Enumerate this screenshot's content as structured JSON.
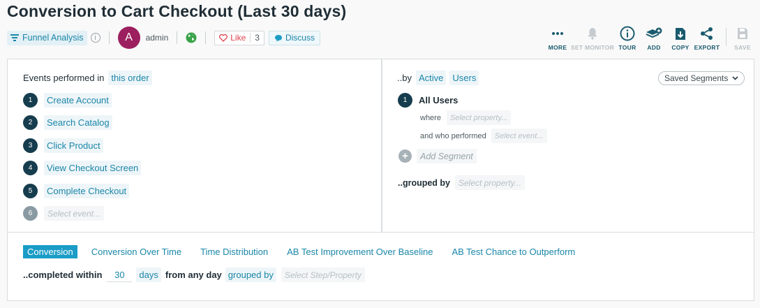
{
  "report": {
    "title": "Conversion to Cart Checkout (Last 30 days)",
    "type_label": "Funnel Analysis",
    "info_glyph": "i",
    "owner_initial": "A",
    "owner_name": "admin",
    "like_label": "Like",
    "like_count": "3",
    "discuss_label": "Discuss",
    "colors": {
      "accent": "#1a86a8",
      "avatar": "#9c1f5f",
      "step": "#163d4e",
      "like": "#e0424f"
    }
  },
  "toolbar": [
    {
      "label": "MORE",
      "icon": "more-icon",
      "disabled": false
    },
    {
      "label": "SET MONITOR",
      "icon": "bell-icon",
      "disabled": true
    },
    {
      "label": "TOUR",
      "icon": "info-icon",
      "disabled": false
    },
    {
      "label": "ADD",
      "icon": "add-stack-icon",
      "disabled": false
    },
    {
      "label": "COPY",
      "icon": "copy-icon",
      "disabled": false
    },
    {
      "label": "EXPORT",
      "icon": "share-icon",
      "disabled": false
    },
    {
      "label": "SAVE",
      "icon": "save-icon",
      "disabled": true
    }
  ],
  "events": {
    "prefix": "Events performed in",
    "order": "this order",
    "steps": [
      "Create Account",
      "Search Catalog",
      "Click Product",
      "View Checkout Screen",
      "Complete Checkout"
    ],
    "next_number": "6",
    "next_placeholder": "Select event..."
  },
  "segments": {
    "by_label": "..by",
    "active": "Active",
    "users": "Users",
    "saved_segments": "Saved Segments",
    "segment_number": "1",
    "segment_name": "All Users",
    "where_label": "where",
    "where_placeholder": "Select property...",
    "who_label": "and who performed",
    "who_placeholder": "Select event...",
    "add_segment": "Add Segment",
    "grouped_label": "..grouped by",
    "grouped_placeholder": "Select property..."
  },
  "tabs": [
    "Conversion",
    "Conversion Over Time",
    "Time Distribution",
    "AB Test Improvement Over Baseline",
    "AB Test Chance to Outperform"
  ],
  "active_tab": 0,
  "completion": {
    "label": "..completed within",
    "value": "30",
    "unit": "days",
    "from_label": "from any day",
    "grouped_label": "grouped by",
    "grouped_placeholder": "Select Step/Property"
  }
}
